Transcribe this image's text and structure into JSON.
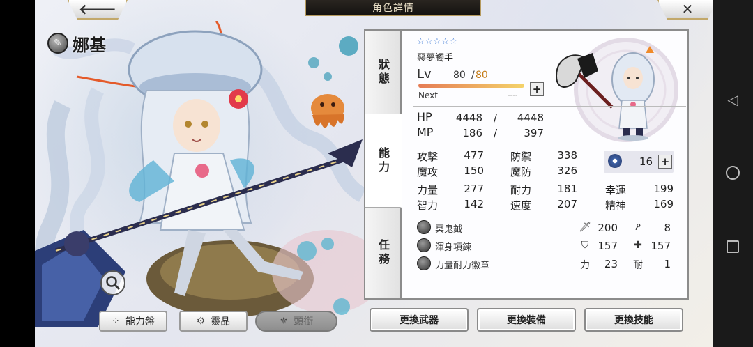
{
  "header": {
    "title": "角色詳情",
    "back_symbol": "🡐",
    "close_symbol": "✕"
  },
  "character": {
    "name": "娜基",
    "stars": "☆☆☆☆☆",
    "epithet": "惡夢觸手"
  },
  "tabs": [
    {
      "label": "狀態"
    },
    {
      "label": "能力"
    },
    {
      "label": "任務"
    }
  ],
  "level": {
    "label": "Lv",
    "current": "80",
    "separator": "/",
    "max": "80",
    "next_label": "Next",
    "next_value": "----",
    "progress": 1.0
  },
  "vitals": {
    "hp_label": "HP",
    "hp_current": "4448",
    "hp_max": "4448",
    "mp_label": "MP",
    "mp_current": "186",
    "mp_max": "397",
    "sep": "/"
  },
  "combat": {
    "attack_label": "攻擊",
    "attack": "477",
    "defense_label": "防禦",
    "defense": "338",
    "mattack_label": "魔攻",
    "mattack": "150",
    "mdefense_label": "魔防",
    "mdefense": "326"
  },
  "crystal_points": "16",
  "attributes": {
    "str_label": "力量",
    "str": "277",
    "vit_label": "耐力",
    "vit": "181",
    "luck_label": "幸運",
    "luck": "199",
    "int_label": "智力",
    "int": "142",
    "spd_label": "速度",
    "spd": "207",
    "spi_label": "精神",
    "spi": "169"
  },
  "equipment": {
    "weapon": "冥鬼鉞",
    "armor": "渾身項鍊",
    "badge": "力量耐力徽章",
    "sword_val": "200",
    "wand_val": "8",
    "shield_val": "157",
    "cross_val": "157",
    "power_label": "力",
    "power_val": "23",
    "endure_label": "耐",
    "endure_val": "1"
  },
  "bottom_left": {
    "ability_board": "能力盤",
    "crystal": "靈晶",
    "title": "頭銜"
  },
  "bottom_right": {
    "weapon": "更換武器",
    "equip": "更換裝備",
    "skill": "更換技能"
  },
  "colors": {
    "star_blue": "#2e6fd2",
    "level_max": "#c47b16",
    "panel_border": "#8c8c8c"
  }
}
